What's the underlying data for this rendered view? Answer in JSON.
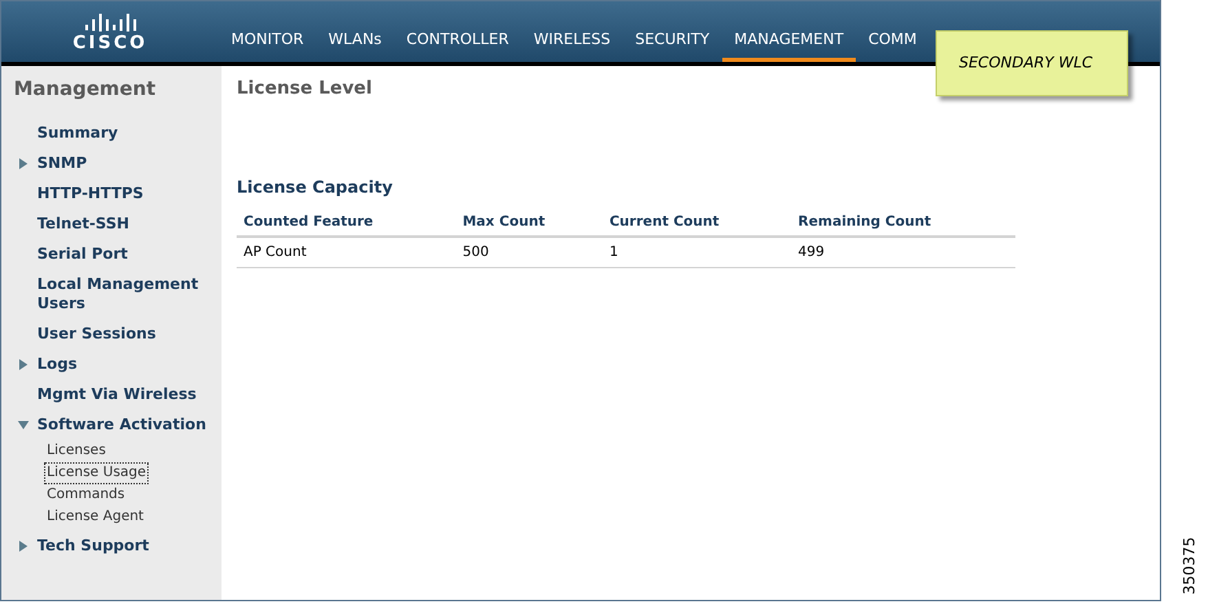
{
  "logo": {
    "text": "CISCO"
  },
  "nav": [
    {
      "label": "MONITOR",
      "selected": false
    },
    {
      "label": "WLANs",
      "selected": false
    },
    {
      "label": "CONTROLLER",
      "selected": false
    },
    {
      "label": "WIRELESS",
      "selected": false
    },
    {
      "label": "SECURITY",
      "selected": false
    },
    {
      "label": "MANAGEMENT",
      "selected": true
    },
    {
      "label": "COMM",
      "selected": false
    }
  ],
  "sticky_note": {
    "text": "SECONDARY WLC"
  },
  "sidebar": {
    "title": "Management",
    "items": [
      {
        "label": "Summary",
        "kind": "link"
      },
      {
        "label": "SNMP",
        "kind": "folder",
        "expanded": false
      },
      {
        "label": "HTTP-HTTPS",
        "kind": "link"
      },
      {
        "label": "Telnet-SSH",
        "kind": "link"
      },
      {
        "label": "Serial Port",
        "kind": "link"
      },
      {
        "label": "Local Management Users",
        "kind": "link"
      },
      {
        "label": "User Sessions",
        "kind": "link"
      },
      {
        "label": "Logs",
        "kind": "folder",
        "expanded": false
      },
      {
        "label": "Mgmt Via Wireless",
        "kind": "link"
      },
      {
        "label": "Software Activation",
        "kind": "folder",
        "expanded": true,
        "children": [
          {
            "label": "Licenses",
            "selected": false
          },
          {
            "label": "License Usage",
            "selected": true
          },
          {
            "label": "Commands",
            "selected": false
          },
          {
            "label": "License Agent",
            "selected": false
          }
        ]
      },
      {
        "label": "Tech Support",
        "kind": "folder",
        "expanded": false
      }
    ]
  },
  "page_title": "License Level",
  "section_title": "License Capacity",
  "table": {
    "columns": [
      "Counted Feature",
      "Max Count",
      "Current Count",
      "Remaining Count"
    ],
    "rows": [
      [
        "AP Count",
        "500",
        "1",
        "499"
      ]
    ]
  },
  "figure_number": "350375"
}
